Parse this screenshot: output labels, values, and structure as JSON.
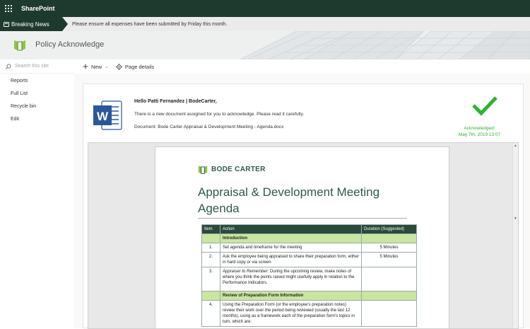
{
  "suite": {
    "title": "SharePoint"
  },
  "news": {
    "label": "Breaking News",
    "message": "Please ensure all expenses have been submitted by Friday this month."
  },
  "site": {
    "title": "Policy Acknowledge"
  },
  "nav": {
    "search_placeholder": "Search this site",
    "items": [
      "Reports",
      "Full List",
      "Recycle bin",
      "Edit"
    ]
  },
  "commands": {
    "new": "New",
    "page_details": "Page details"
  },
  "card": {
    "hello": "Hello Patti Fernandez | BodeCarter,",
    "description": "There is a new document assigned for you to acknowledge. Please read it carefully.",
    "document": "Document: Bode Carter Appraisal & Development Meeting - Agenda.docx",
    "ack_label": "Acknowledged:",
    "ack_date": "May 7th, 2019 13:07"
  },
  "doc": {
    "brand": "BODE CARTER",
    "title": "Appraisal & Development Meeting Agenda",
    "columns": [
      "Item",
      "Action",
      "Duration (Suggested)"
    ],
    "sections": [
      {
        "name": "Introduction",
        "rows": [
          {
            "item": "1.",
            "action": "Set agenda and timeframe for the meeting",
            "duration": "5 Minutes"
          },
          {
            "item": "2.",
            "action": "Ask the employee being appraised to share their preparation form, either in hard copy or via screen",
            "duration": "5 Minutes"
          },
          {
            "item": "3.",
            "action_em": "Appraiser to Remember:",
            "action": " During the upcoming review, make notes of where you think the points raised might usefully apply in relation to the Performance Indicators.",
            "duration": ""
          }
        ]
      },
      {
        "name": "Review of Preparation Form Information",
        "rows": [
          {
            "item": "4.",
            "action": "Using the Preparation Form (or the employee's preparation notes) review their work over the period being reviewed (usually the last 12 months), using as a framework each of the preparation form's topics in turn, which are:",
            "duration": ""
          }
        ]
      }
    ]
  },
  "colors": {
    "suite_bg": "#1e3a2f",
    "accent_green": "#2eb32e",
    "brand_green": "#2d5a46",
    "section_bg": "#c8e6a0",
    "word_blue": "#2b579a"
  }
}
